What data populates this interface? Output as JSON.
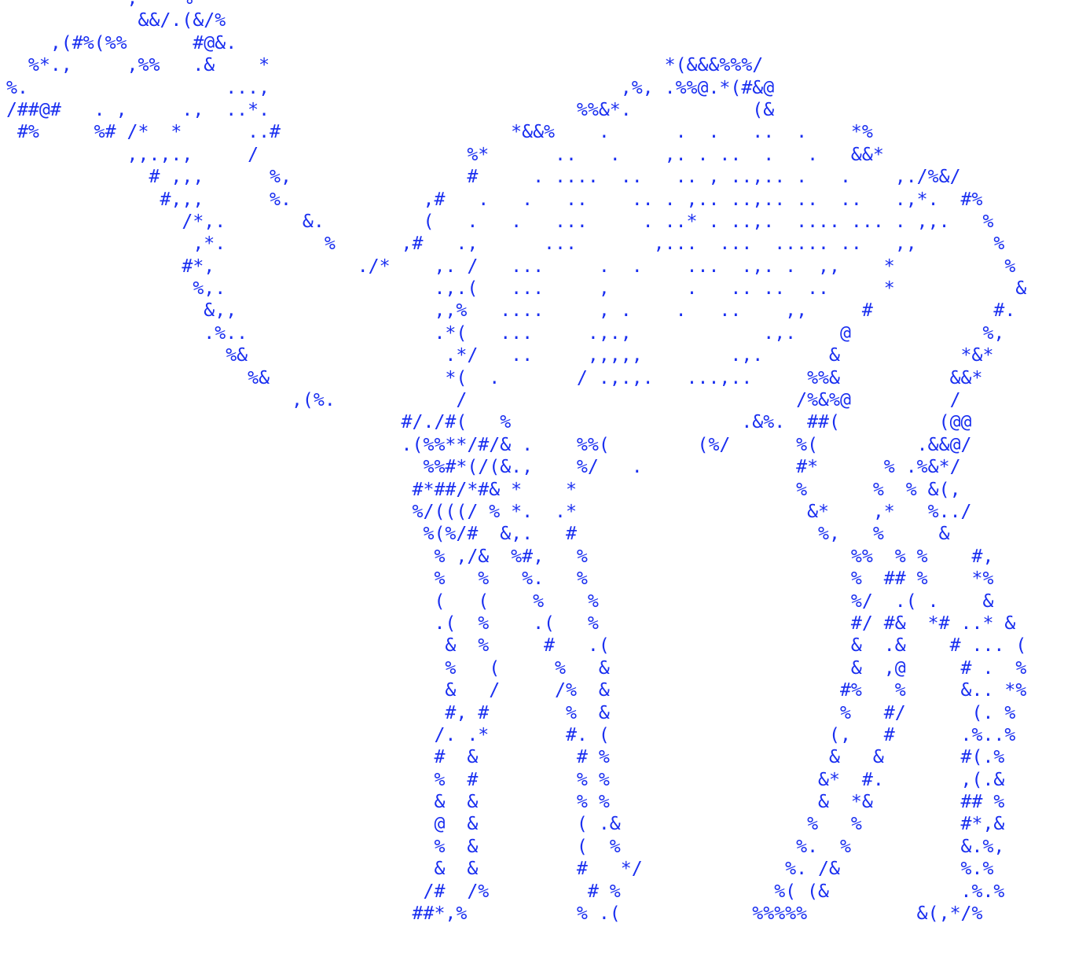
{
  "art": {
    "color": "#1a2ff0",
    "lines": [
      "           ,    %                                                                  ",
      "            &&/.(&/%                                                              ",
      "    ,(#%(%%      #@&.                                                             ",
      "  %*.,     ,%%   .&    *                                    *(&&&%%%/             ",
      "%.                  ...,                                ,%, .%%@.*(#&@            ",
      "/##@#   . ,     .,  ..*.                            %%&*.           (&            ",
      " #%     %# /*  *      ..#                     *&&%    .      .  .   ..  .    *%   ",
      "           ,,.,.,     /                   %*      ..   .    ,. . ..  .   .   &&*  ",
      "             # ,,,      %,                #     . ....  ..   .. , ..,.. .   .    ,./%&/",
      "              #,,,      %.            ,#   .   .   ..    .. . ,.. ..,.. ..  ..   .,*.  #%",
      "                /*,.       &.         (   .   .   ...     . ..* . ..,.  .... ... . ,,.   %",
      "                 ,*.         %      ,#   .,      ...       ,...  ...  ..... ..   ,,       %",
      "                #*,             ./*    ,. /   ...     .  .    ...  .,. .  ,,    *          %",
      "                 %,.                   .,.(   ...     ,       .   .. ..  ..     *           &",
      "                  &,,                  ,,%   ....     , .    .   ..    ,,     #           #.",
      "                  .%..                 .*(   ...     .,.,            .,.    @            %,",
      "                    %&                  .*/   ..     ,,,,,        .,.      &           *&*",
      "                      %&                *(  .       / .,.,.   ...,..     %%&          &&*",
      "                          ,(%.           /                              /%&%@         /",
      "                                    #/./#(   %                     .&%.  ##(         (@@",
      "                                    .(%%**/#/& .    %%(        (%/      %(         .&&@/",
      "                                      %%#*(/(&.,    %/   .              #*      % .%&*/",
      "                                     #*##/*#& *    *                    %      %  % &(,",
      "                                     %/(((/ % *.  .*                     &*    ,*   %../",
      "                                      %(%/#  &,.   #                      %,   %     &",
      "                                       % ,/&  %#,   %                        %%  % %    #,",
      "                                       %   %   %.   %                        %  ## %    *%",
      "                                       (   (    %    %                       %/  .( .    &",
      "                                       .(  %    .(   %                       #/ #&  *# ..* &",
      "                                        &  %     #   .(                      &  .&    # ... (",
      "                                        %   (     %   &                      &  ,@     # .  %",
      "                                        &   /     /%  &                     #%   %     &.. *%",
      "                                        #, #       %  &                     %   #/      (. %",
      "                                       /. .*       #. (                    (,   #      .%..%",
      "                                       #  &         # %                    &   &       #(.%",
      "                                       %  #         % %                   &*  #.       ,(.&",
      "                                       &  &         % %                   &  *&        ## %",
      "                                       @  &         ( .&                 %   %         #*,&",
      "                                       %  &         (  %                %.  %          &.%,",
      "                                       &  &         #   */             %. /&           %.%",
      "                                      /#  /%         # %              %( (&            .%.%",
      "                                     ##*,%          % .(            %%%%%          &(,*/%"
    ]
  }
}
